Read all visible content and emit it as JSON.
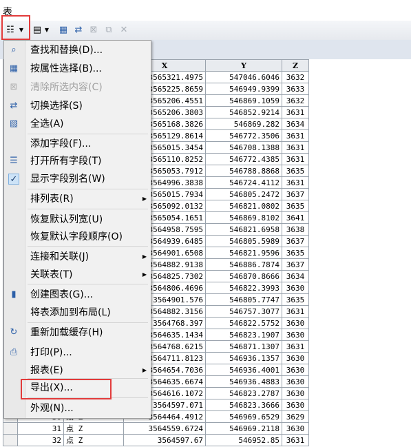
{
  "window": {
    "title": "表"
  },
  "toolbar": {
    "buttons": [
      {
        "icon": "table-options-icon"
      },
      {
        "icon": "related-tables-icon"
      },
      {
        "icon": "select-by-attributes-icon"
      },
      {
        "icon": "switch-selection-icon"
      },
      {
        "icon": "clear-selection-icon"
      },
      {
        "icon": "zoom-to-selected-icon"
      },
      {
        "icon": "delete-selected-icon"
      }
    ]
  },
  "colors": {
    "highlight_box": "#e23b3b"
  },
  "table": {
    "columns": [
      "",
      "",
      "",
      "X",
      "Y",
      "Z"
    ],
    "rows": [
      {
        "x": "3565321.4975",
        "y": "547046.6046",
        "z": "3632"
      },
      {
        "x": "3565225.8659",
        "y": "546949.9399",
        "z": "3633"
      },
      {
        "x": "3565206.4551",
        "y": "546869.1059",
        "z": "3632"
      },
      {
        "x": "3565206.3803",
        "y": "546852.9214",
        "z": "3631"
      },
      {
        "x": "3565168.3826",
        "y": "546869.282",
        "z": "3634"
      },
      {
        "x": "3565129.8614",
        "y": "546772.3506",
        "z": "3631"
      },
      {
        "x": "3565015.3454",
        "y": "546708.1388",
        "z": "3631"
      },
      {
        "x": "3565110.8252",
        "y": "546772.4385",
        "z": "3631"
      },
      {
        "x": "3565053.7912",
        "y": "546788.8868",
        "z": "3635"
      },
      {
        "x": "3564996.3838",
        "y": "546724.4112",
        "z": "3631"
      },
      {
        "x": "3565015.7934",
        "y": "546805.2472",
        "z": "3637"
      },
      {
        "x": "3565092.0132",
        "y": "546821.0802",
        "z": "3635"
      },
      {
        "x": "3565054.1651",
        "y": "546869.8102",
        "z": "3641"
      },
      {
        "x": "3564958.7595",
        "y": "546821.6958",
        "z": "3638"
      },
      {
        "x": "3564939.6485",
        "y": "546805.5989",
        "z": "3637"
      },
      {
        "x": "3564901.6508",
        "y": "546821.9596",
        "z": "3635"
      },
      {
        "x": "3564882.9138",
        "y": "546886.7874",
        "z": "3637"
      },
      {
        "x": "3564825.7302",
        "y": "546870.8666",
        "z": "3634"
      },
      {
        "x": "3564806.4696",
        "y": "546822.3993",
        "z": "3630"
      },
      {
        "x": "3564901.576",
        "y": "546805.7747",
        "z": "3635"
      },
      {
        "x": "3564882.3156",
        "y": "546757.3077",
        "z": "3631"
      },
      {
        "x": "3564768.397",
        "y": "546822.5752",
        "z": "3630"
      },
      {
        "x": "3564635.1434",
        "y": "546823.1907",
        "z": "3630"
      },
      {
        "x": "3564768.6215",
        "y": "546871.1307",
        "z": "3631"
      },
      {
        "x": "3564711.8123",
        "y": "546936.1357",
        "z": "3630"
      },
      {
        "x": "3564654.7036",
        "y": "546936.4001",
        "z": "3630"
      },
      {
        "x": "3564635.6674",
        "y": "546936.4883",
        "z": "3630"
      },
      {
        "x": "3564616.1072",
        "y": "546823.2787",
        "z": "3630"
      },
      {
        "x": "3564597.071",
        "y": "546823.3666",
        "z": "3630"
      },
      {
        "fid": "30",
        "shape": "点 Z",
        "x": "3564464.4912",
        "y": "546969.6529",
        "z": "3629"
      },
      {
        "fid": "31",
        "shape": "点 Z",
        "x": "3564559.6724",
        "y": "546969.2118",
        "z": "3630"
      },
      {
        "fid": "32",
        "shape": "点 Z",
        "x": "3564597.67",
        "y": "546952.85",
        "z": "3631"
      }
    ]
  },
  "menu": {
    "items": [
      {
        "icon": "binoculars-icon",
        "label": "查找和替换(D)..."
      },
      {
        "icon": "select-by-attributes-icon",
        "label": "按属性选择(B)..."
      },
      {
        "icon": "clear-selection-icon",
        "label": "清除所选内容(C)",
        "disabled": true
      },
      {
        "icon": "switch-selection-icon",
        "label": "切换选择(S)"
      },
      {
        "icon": "select-all-icon",
        "label": "全选(A)"
      },
      {
        "label": "添加字段(F)..."
      },
      {
        "icon": "field-list-icon",
        "label": "打开所有字段(T)"
      },
      {
        "icon": "check-icon",
        "label": "显示字段别名(W)"
      },
      {
        "label": "排列表(R)",
        "submenu": true
      },
      {
        "label": "恢复默认列宽(U)"
      },
      {
        "label": "恢复默认字段顺序(O)"
      },
      {
        "label": "连接和关联(J)",
        "submenu": true
      },
      {
        "label": "关联表(T)",
        "submenu": true
      },
      {
        "icon": "bar-chart-icon",
        "label": "创建图表(G)..."
      },
      {
        "label": "将表添加到布局(L)"
      },
      {
        "icon": "refresh-icon",
        "label": "重新加载缓存(H)"
      },
      {
        "icon": "printer-icon",
        "label": "打印(P)..."
      },
      {
        "label": "报表(E)",
        "submenu": true
      },
      {
        "label": "导出(X)..."
      },
      {
        "label": "外观(N)..."
      }
    ]
  }
}
